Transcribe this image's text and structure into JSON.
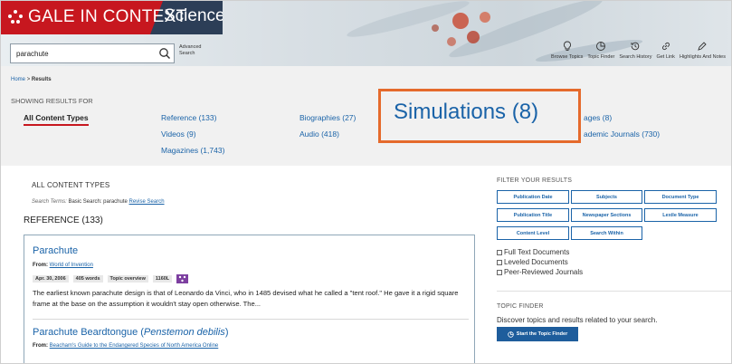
{
  "header": {
    "brand": "GALE IN CONTEXT",
    "product": "Science",
    "search_value": "parachute",
    "advanced_search": "Advanced Search",
    "toolbar": [
      {
        "label": "Browse Topics",
        "icon": "lightbulb-icon"
      },
      {
        "label": "Topic Finder",
        "icon": "topic-finder-icon"
      },
      {
        "label": "Search History",
        "icon": "history-icon"
      },
      {
        "label": "Get Link",
        "icon": "link-icon"
      },
      {
        "label": "Highlights And Notes",
        "icon": "pencil-icon"
      }
    ],
    "colors": {
      "brand_red": "#c7171f",
      "brand_navy": "#2c3e57"
    }
  },
  "breadcrumb": {
    "home": "Home",
    "separator": ">",
    "current": "Results"
  },
  "showing_label": "SHOWING RESULTS FOR",
  "content_types": {
    "all": "All Content Types",
    "reference": "Reference (133)",
    "videos": "Videos (9)",
    "magazines": "Magazines (1,743)",
    "biographies": "Biographies (27)",
    "audio": "Audio (418)",
    "images_partial": "ages (8)",
    "academic_partial": "ademic Journals (730)"
  },
  "callout": {
    "text": "Simulations (8)",
    "border_color": "#e56a2c"
  },
  "results": {
    "section_label": "ALL CONTENT TYPES",
    "search_terms_label": "Search Terms:",
    "search_terms_value": "Basic Search: parachute",
    "revise_search": "Revise Search",
    "reference_heading": "REFERENCE (133)",
    "items": [
      {
        "title": "Parachute",
        "from_label": "From:",
        "source": "World of Invention",
        "meta": [
          "Apr. 30, 2006",
          "405 words",
          "Topic overview",
          "1160L"
        ],
        "snippet": "The earliest known parachute design is that of Leonardo da Vinci, who in 1485 devised what he called a \"tent roof.\" He gave it a rigid square frame at the base on the assumption it wouldn't stay open otherwise. The..."
      },
      {
        "title_plain": "Parachute Beardtongue (",
        "title_italic": "Penstemon debilis",
        "title_end": ")",
        "from_label": "From:",
        "source": "Beacham's Guide to the Endangered Species of North America Online"
      }
    ]
  },
  "filters": {
    "title": "FILTER YOUR RESULTS",
    "buttons": [
      "Publication Date",
      "Subjects",
      "Document Type",
      "Publication Title",
      "Newspaper Sections",
      "Lexile Measure",
      "Content Level",
      "Search Within"
    ],
    "checkboxes": [
      "Full Text Documents",
      "Leveled Documents",
      "Peer-Reviewed Journals"
    ]
  },
  "topic_finder": {
    "title": "TOPIC FINDER",
    "description": "Discover topics and results related to your search.",
    "button": "Start the Topic Finder"
  }
}
